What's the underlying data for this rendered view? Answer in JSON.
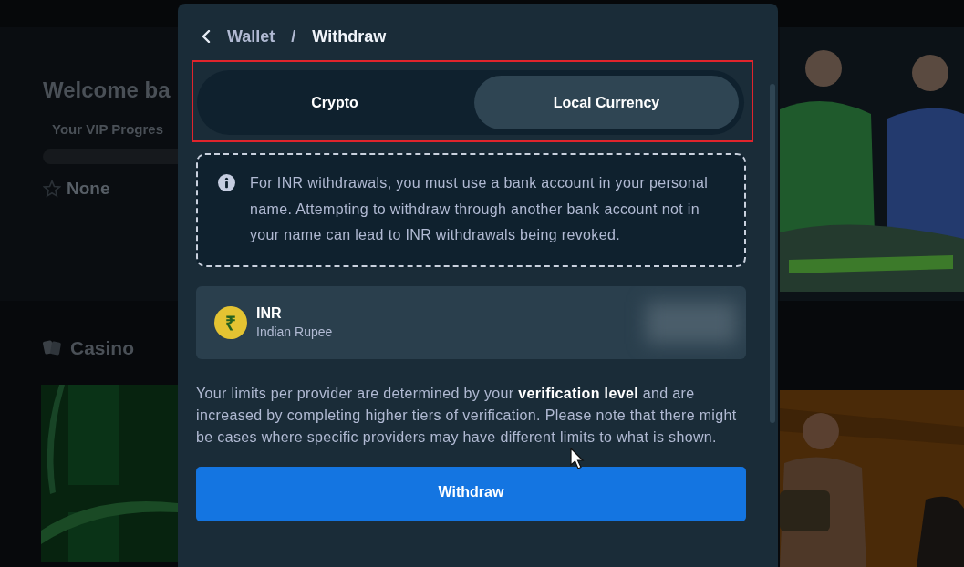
{
  "background": {
    "welcome": "Welcome ba",
    "vip_label": "Your VIP Progres",
    "vip_progress": {
      "level": 0
    },
    "vip_tier": "None",
    "section_title": "Casino"
  },
  "modal": {
    "breadcrumb": {
      "parent": "Wallet",
      "separator": "/",
      "current": "Withdraw"
    },
    "tabs": [
      {
        "label": "Crypto",
        "selected": false
      },
      {
        "label": "Local Currency",
        "selected": true
      }
    ],
    "notice": "For INR withdrawals, you must use a bank account in your personal name. Attempting to withdraw through another bank account not in your name can lead to INR withdrawals being revoked.",
    "currency": {
      "symbol": "₹",
      "code": "INR",
      "name": "Indian Rupee"
    },
    "limits_note": "Your limits per provider are determined by your **verification level** and are increased by completing higher tiers of verification. Please note that there might be cases where specific providers may have different limits to what is shown.",
    "button": "Withdraw"
  }
}
